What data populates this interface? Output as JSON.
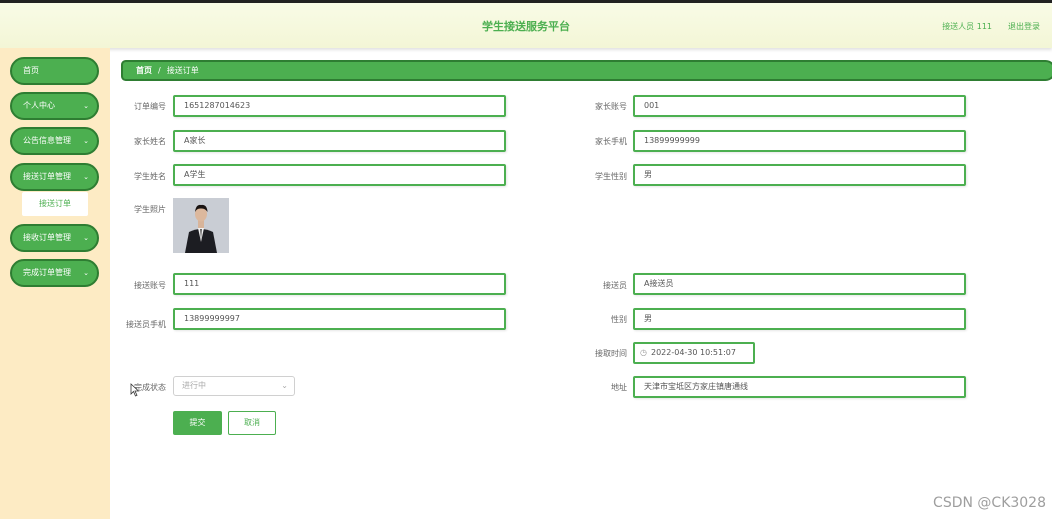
{
  "header": {
    "title": "学生接送服务平台",
    "user": "接送人员 111",
    "logout": "退出登录"
  },
  "sidebar": {
    "items": [
      {
        "label": "首页",
        "chevron": ""
      },
      {
        "label": "个人中心",
        "chevron": "⌄"
      },
      {
        "label": "公告信息管理",
        "chevron": "⌄"
      },
      {
        "label": "接送订单管理",
        "chevron": "⌄"
      },
      {
        "label": "接收订单管理",
        "chevron": "⌄"
      },
      {
        "label": "完成订单管理",
        "chevron": "⌄"
      }
    ],
    "submenu_active": "接送订单"
  },
  "breadcrumb": {
    "home": "首页",
    "sep": "/",
    "current": "接送订单"
  },
  "form": {
    "order_no": {
      "label": "订单编号",
      "value": "1651287014623"
    },
    "parent_account": {
      "label": "家长账号",
      "value": "001"
    },
    "parent_name": {
      "label": "家长姓名",
      "value": "A家长"
    },
    "parent_phone": {
      "label": "家长手机",
      "value": "13899999999"
    },
    "student_name": {
      "label": "学生姓名",
      "value": "A学生"
    },
    "student_gender": {
      "label": "学生性别",
      "value": "男"
    },
    "student_photo": {
      "label": "学生照片"
    },
    "driver_account": {
      "label": "接送账号",
      "value": "111"
    },
    "driver_name": {
      "label": "接送员",
      "value": "A接送员"
    },
    "driver_phone": {
      "label": "接送员手机",
      "value": "13899999997"
    },
    "driver_gender": {
      "label": "性别",
      "value": "男"
    },
    "pickup_time": {
      "label": "接取时间",
      "value": "2022-04-30 10:51:07"
    },
    "status": {
      "label": "完成状态",
      "value": "进行中"
    },
    "address": {
      "label": "地址",
      "value": "天津市宝坻区方家庄镇唐通线"
    }
  },
  "buttons": {
    "submit": "提交",
    "cancel": "取消"
  },
  "watermark": "CSDN @CK3028"
}
